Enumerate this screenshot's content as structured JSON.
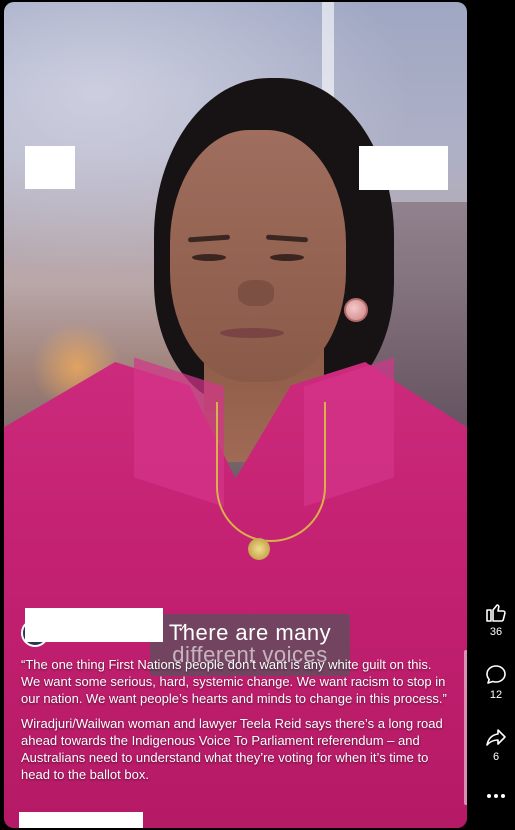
{
  "video": {
    "caption_line1": "There are many",
    "caption_line2": "different voices"
  },
  "post": {
    "verified_glyph": "✓",
    "paragraph1": "“The one thing First Nations people don’t want is any white guilt on this. We want some serious, hard, systemic change. We want racism to stop in our nation. We want people’s hearts and minds to change in this process.”",
    "paragraph2": "Wiradjuri/Wailwan woman and lawyer Teela Reid says there’s a long road ahead towards the Indigenous Voice To Parliament referendum – and Australians need to understand what they’re voting for when it’s time to head to the ballot box."
  },
  "actions": {
    "like_count": "36",
    "comment_count": "12",
    "share_count": "6"
  },
  "icons": {
    "like": "thumbs-up-icon",
    "comment": "comment-bubble-icon",
    "share": "share-arrow-icon",
    "more": "more-horizontal-icon"
  },
  "colors": {
    "background": "#000000",
    "shirt": "#c42172",
    "text": "#ffffff"
  }
}
